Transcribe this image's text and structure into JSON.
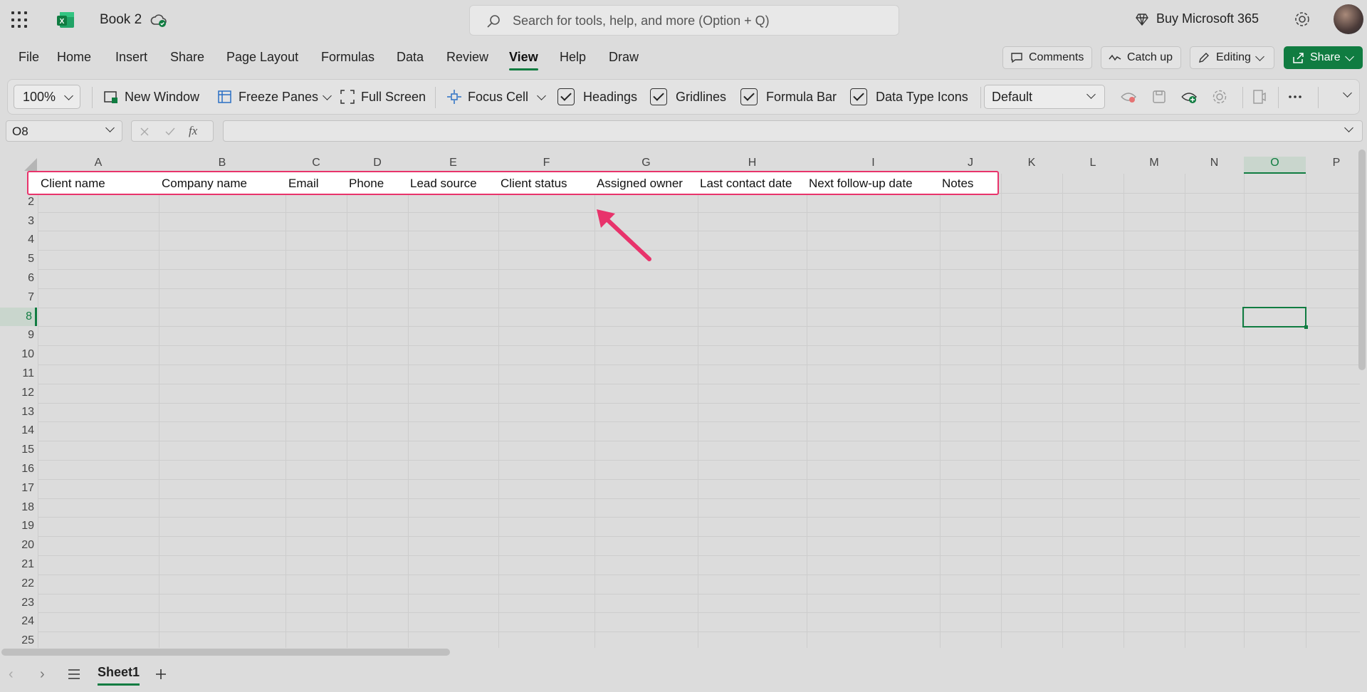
{
  "app": {
    "title": "Book 2",
    "search_placeholder": "Search for tools, help, and more (Option + Q)",
    "buy_label": "Buy Microsoft 365"
  },
  "menu": {
    "tabs": [
      "File",
      "Home",
      "Insert",
      "Share",
      "Page Layout",
      "Formulas",
      "Data",
      "Review",
      "View",
      "Help",
      "Draw"
    ],
    "active": "View",
    "comments_label": "Comments",
    "catchup_label": "Catch up",
    "editing_label": "Editing",
    "share_label": "Share"
  },
  "ribbon": {
    "zoom": "100%",
    "new_window": "New Window",
    "freeze_panes": "Freeze Panes",
    "full_screen": "Full Screen",
    "focus_cell": "Focus Cell",
    "headings": "Headings",
    "gridlines": "Gridlines",
    "formula_bar": "Formula Bar",
    "data_type_icons": "Data Type Icons",
    "view_select": "Default"
  },
  "formula_bar": {
    "name_box": "O8",
    "value": ""
  },
  "sheet": {
    "columns": [
      "A",
      "B",
      "C",
      "D",
      "E",
      "F",
      "G",
      "H",
      "I",
      "J",
      "K",
      "L",
      "M",
      "N",
      "O",
      "P"
    ],
    "selected_column": "O",
    "rows": [
      "1",
      "2",
      "3",
      "4",
      "5",
      "6",
      "7",
      "8",
      "9",
      "10",
      "11",
      "12",
      "13",
      "14",
      "15",
      "16",
      "17",
      "18",
      "19",
      "20",
      "21",
      "22",
      "23",
      "24",
      "25"
    ],
    "selected_row": "8",
    "header_cells": [
      "Client name",
      "Company name",
      "Email",
      "Phone",
      "Lead source",
      "Client status",
      "Assigned owner",
      "Last contact date",
      "Next follow-up date",
      "Notes"
    ],
    "active_cell": "O8"
  },
  "bottom": {
    "sheet_name": "Sheet1"
  },
  "colors": {
    "accent": "#107c41",
    "highlight": "#e8336b"
  }
}
